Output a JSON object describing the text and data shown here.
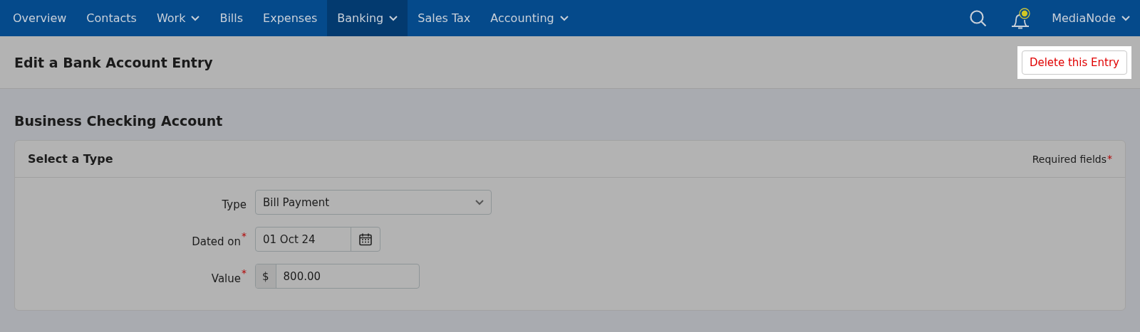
{
  "nav": {
    "items": [
      {
        "label": "Overview",
        "dropdown": false,
        "selected": false
      },
      {
        "label": "Contacts",
        "dropdown": false,
        "selected": false
      },
      {
        "label": "Work",
        "dropdown": true,
        "selected": false
      },
      {
        "label": "Bills",
        "dropdown": false,
        "selected": false
      },
      {
        "label": "Expenses",
        "dropdown": false,
        "selected": false
      },
      {
        "label": "Banking",
        "dropdown": true,
        "selected": true
      },
      {
        "label": "Sales Tax",
        "dropdown": false,
        "selected": false
      },
      {
        "label": "Accounting",
        "dropdown": true,
        "selected": false
      }
    ],
    "account": {
      "label": "MediaNode",
      "dropdown": true
    }
  },
  "page_header": {
    "title": "Edit a Bank Account Entry",
    "delete_button": "Delete this Entry"
  },
  "section_title": "Business Checking Account",
  "card": {
    "title": "Select a Type",
    "required_note": "Required fields",
    "required_mark": "*",
    "fields": [
      {
        "kind": "select",
        "label": "Type",
        "required": false,
        "value": "Bill Payment"
      },
      {
        "kind": "date",
        "label": "Dated on",
        "required": true,
        "value": "01 Oct 24"
      },
      {
        "kind": "money",
        "label": "Value",
        "required": true,
        "prefix": "$",
        "value": "800.00"
      }
    ]
  }
}
